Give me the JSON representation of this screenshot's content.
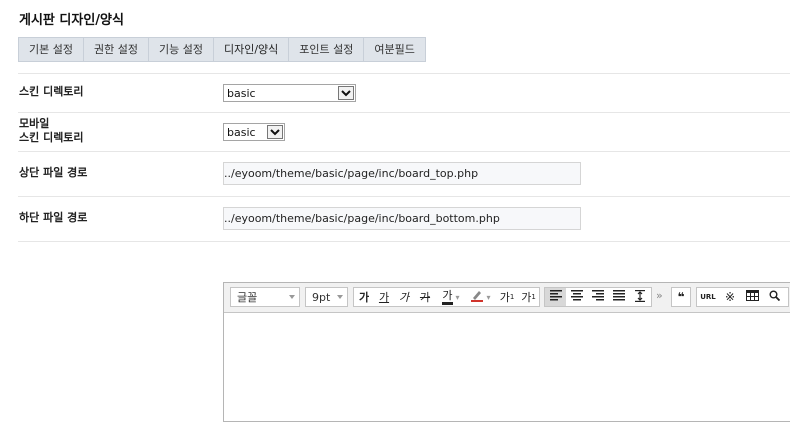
{
  "page": {
    "title": "게시판 디자인/양식"
  },
  "tabs": [
    {
      "label": "기본 설정"
    },
    {
      "label": "권한 설정"
    },
    {
      "label": "기능 설정"
    },
    {
      "label": "디자인/양식"
    },
    {
      "label": "포인트 설정"
    },
    {
      "label": "여분필드"
    }
  ],
  "form": {
    "skin_dir": {
      "label": "스킨 디렉토리",
      "value": "basic"
    },
    "mobile_skin_dir": {
      "label_line1": "모바일",
      "label_line2": "스킨 디렉토리",
      "value": "basic"
    },
    "top_file": {
      "label": "상단 파일 경로",
      "value": "../eyoom/theme/basic/page/inc/board_top.php"
    },
    "bottom_file": {
      "label": "하단 파일 경로",
      "value": "../eyoom/theme/basic/page/inc/board_bottom.php"
    }
  },
  "editor": {
    "font_family": "글꼴",
    "font_size": "9pt",
    "bold_glyph": "가",
    "underline_glyph": "가",
    "italic_glyph": "가",
    "strike_glyph": "가",
    "font_color_glyph": "가",
    "superscript_glyph": "가",
    "superscript_mark": "1",
    "subscript_glyph": "가",
    "subscript_mark": "1",
    "more_glyph": "»",
    "quote_glyph": "❝",
    "url_label": "URL",
    "special_char_glyph": "※"
  }
}
